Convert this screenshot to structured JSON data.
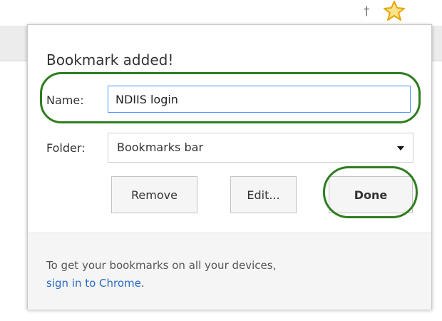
{
  "toolbar": {
    "menu_icon": "pin-icon",
    "star_icon": "star-icon"
  },
  "popup": {
    "title": "Bookmark added!",
    "name_label": "Name:",
    "name_value": "NDIIS login",
    "folder_label": "Folder:",
    "folder_value": "Bookmarks bar",
    "buttons": {
      "remove": "Remove",
      "edit": "Edit...",
      "done": "Done"
    },
    "footer": {
      "line1": "To get your bookmarks on all your devices,",
      "link": "sign in to Chrome",
      "suffix": "."
    }
  },
  "colors": {
    "highlight_ring": "#2e7d1f",
    "link": "#2a6cc6",
    "input_focus_border": "#4d90fe",
    "star_fill": "#fbe38c",
    "star_stroke": "#e6a400"
  }
}
